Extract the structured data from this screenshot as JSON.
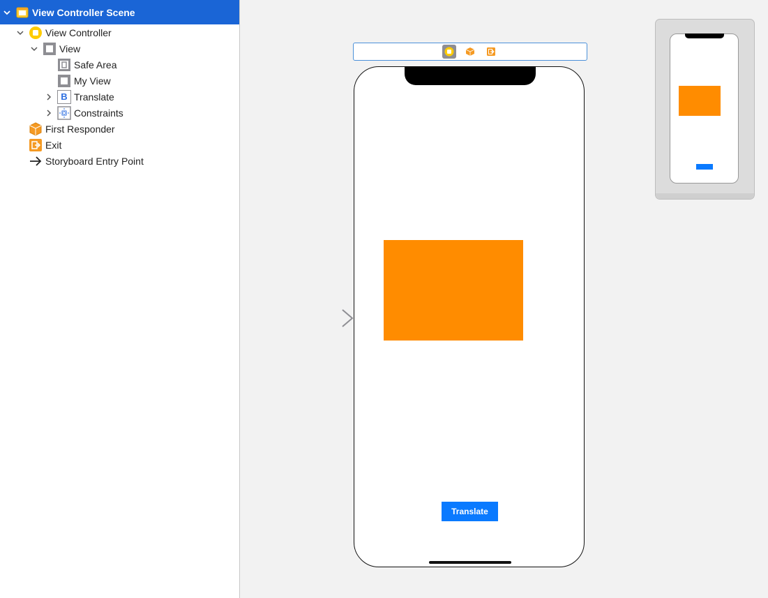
{
  "outline": {
    "scene_title": "View Controller Scene",
    "items": [
      {
        "label": "View Controller"
      },
      {
        "label": "View"
      },
      {
        "label": "Safe Area"
      },
      {
        "label": "My View"
      },
      {
        "label": "Translate"
      },
      {
        "label": "Constraints"
      },
      {
        "label": "First Responder"
      },
      {
        "label": "Exit"
      },
      {
        "label": "Storyboard Entry Point"
      }
    ],
    "icons": {
      "scene": "scene-icon",
      "view_controller": "view-controller-icon",
      "view": "view-icon",
      "safe_area": "safe-area-icon",
      "my_view": "view-icon",
      "translate": "button-icon",
      "translate_glyph": "B",
      "constraints": "constraints-icon",
      "first_responder": "first-responder-icon",
      "exit": "exit-icon",
      "entry_point": "arrow-right-icon"
    }
  },
  "canvas": {
    "dock_icons": [
      "view-controller-icon",
      "first-responder-icon",
      "exit-icon"
    ],
    "button_label": "Translate",
    "colors": {
      "orange_view": "#ff8c00",
      "button": "#0a7aff",
      "selection": "#1a65d6"
    }
  }
}
